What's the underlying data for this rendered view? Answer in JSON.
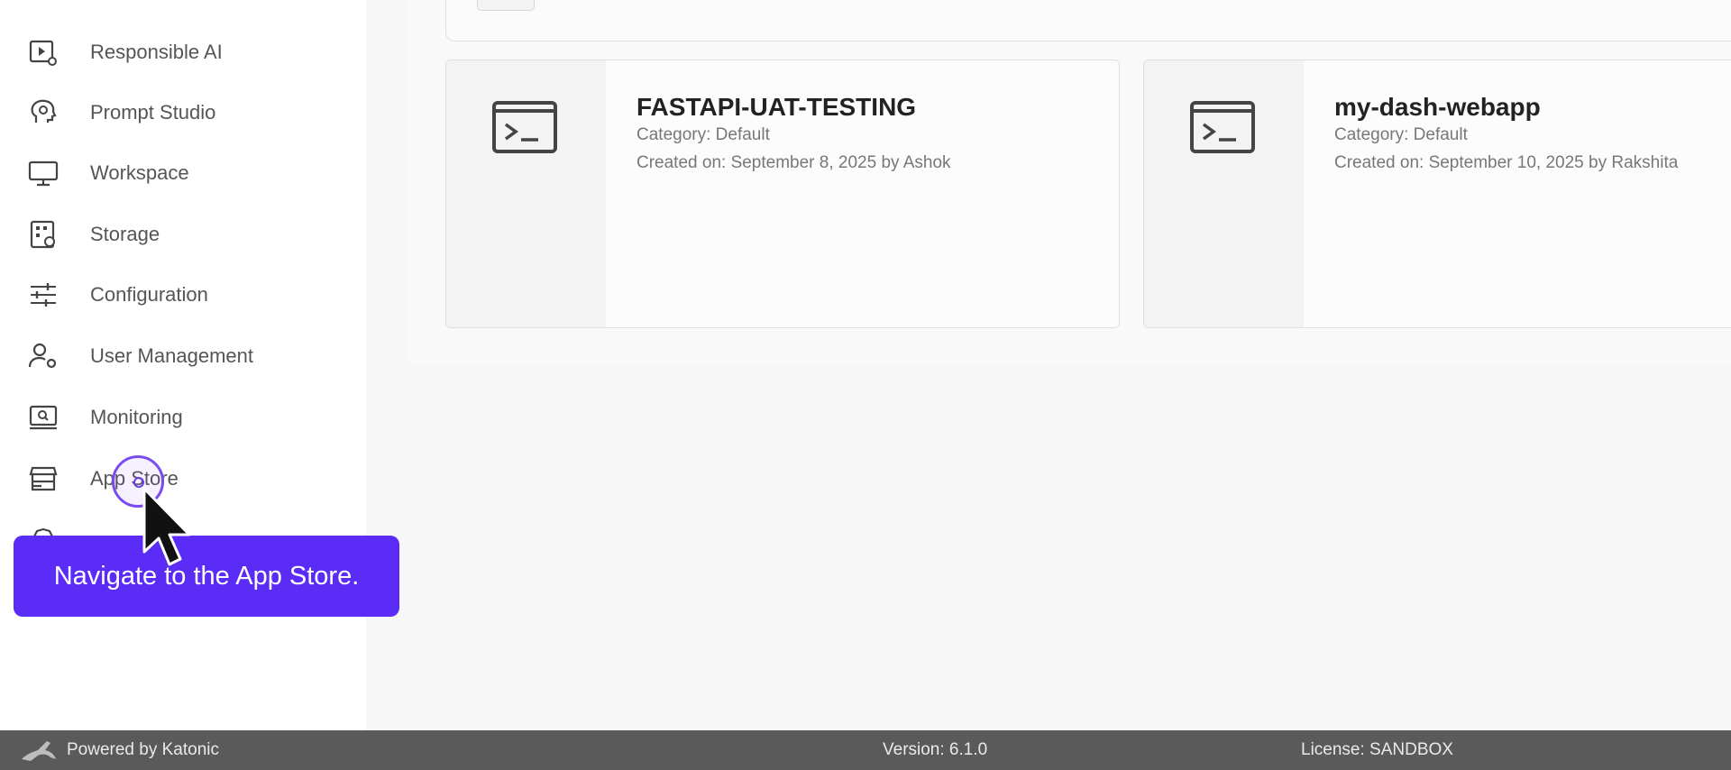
{
  "sidebar": {
    "items": [
      {
        "label": "Responsible AI",
        "icon": "responsible-ai-icon"
      },
      {
        "label": "Prompt Studio",
        "icon": "prompt-studio-icon"
      },
      {
        "label": "Workspace",
        "icon": "monitor-icon"
      },
      {
        "label": "Storage",
        "icon": "storage-icon"
      },
      {
        "label": "Configuration",
        "icon": "sliders-icon"
      },
      {
        "label": "User Management",
        "icon": "user-gear-icon"
      },
      {
        "label": "Monitoring",
        "icon": "monitoring-icon"
      },
      {
        "label": "App Store",
        "icon": "store-icon"
      }
    ]
  },
  "apps": [
    {
      "title": "FASTAPI-UAT-TESTING",
      "category": "Category: Default",
      "created": "Created on: September 8, 2025 by Ashok",
      "icon": "terminal-icon"
    },
    {
      "title": "my-dash-webapp",
      "category": "Category: Default",
      "created": "Created on: September 10, 2025 by Rakshita",
      "icon": "terminal-icon"
    }
  ],
  "tooltip": {
    "text": "Navigate to the App Store."
  },
  "footer": {
    "powered": "Powered by Katonic",
    "version": "Version: 6.1.0",
    "license": "License: SANDBOX"
  },
  "colors": {
    "accent": "#5b2cf5",
    "footer_bg": "#5a5a5a"
  }
}
